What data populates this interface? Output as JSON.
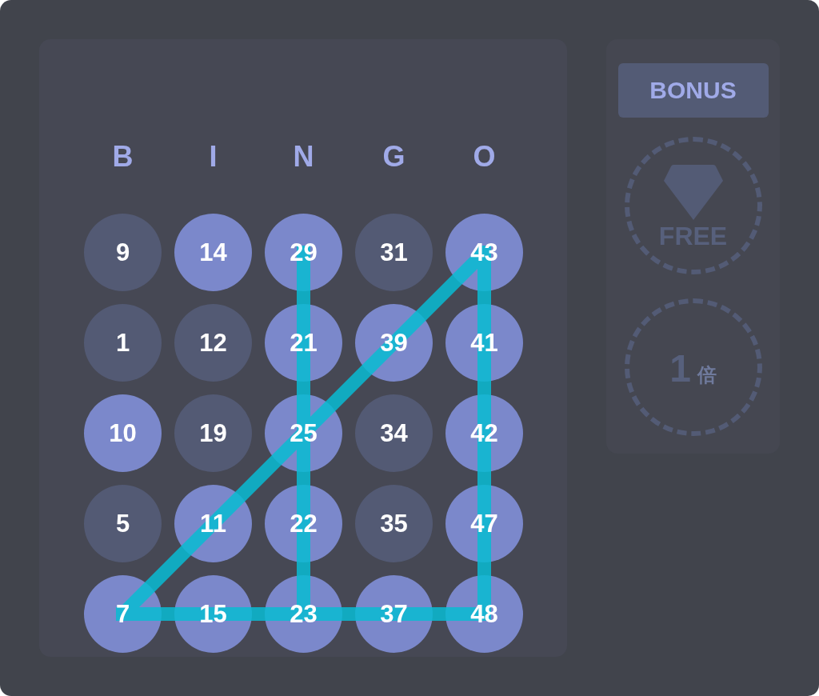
{
  "board": {
    "columns": [
      {
        "letter": "B",
        "line": false
      },
      {
        "letter": "I",
        "line": false
      },
      {
        "letter": "N",
        "line": true
      },
      {
        "letter": "G",
        "line": false
      },
      {
        "letter": "O",
        "line": true
      }
    ],
    "rows": [
      {
        "line": false,
        "cells": [
          {
            "number": "9",
            "marked": false
          },
          {
            "number": "14",
            "marked": true
          },
          {
            "number": "29",
            "marked": true
          },
          {
            "number": "31",
            "marked": false
          },
          {
            "number": "43",
            "marked": true
          }
        ]
      },
      {
        "line": false,
        "cells": [
          {
            "number": "1",
            "marked": false
          },
          {
            "number": "12",
            "marked": false
          },
          {
            "number": "21",
            "marked": true
          },
          {
            "number": "39",
            "marked": true
          },
          {
            "number": "41",
            "marked": true
          }
        ]
      },
      {
        "line": false,
        "cells": [
          {
            "number": "10",
            "marked": true
          },
          {
            "number": "19",
            "marked": false
          },
          {
            "number": "25",
            "marked": true
          },
          {
            "number": "34",
            "marked": false
          },
          {
            "number": "42",
            "marked": true
          }
        ]
      },
      {
        "line": false,
        "cells": [
          {
            "number": "5",
            "marked": false
          },
          {
            "number": "11",
            "marked": true
          },
          {
            "number": "22",
            "marked": true
          },
          {
            "number": "35",
            "marked": false
          },
          {
            "number": "47",
            "marked": true
          }
        ]
      },
      {
        "line": true,
        "cells": [
          {
            "number": "7",
            "marked": true
          },
          {
            "number": "15",
            "marked": true
          },
          {
            "number": "23",
            "marked": true
          },
          {
            "number": "37",
            "marked": true
          },
          {
            "number": "48",
            "marked": true
          }
        ]
      }
    ],
    "diagonals": [
      {
        "kind": "falling",
        "line": false
      },
      {
        "kind": "rising",
        "line": true
      }
    ]
  },
  "side_panel": {
    "bonus_button": {
      "label": "BONUS"
    },
    "free_badge": {
      "label": "FREE"
    },
    "multiplier_badge": {
      "value": "1",
      "unit": "倍"
    }
  }
}
